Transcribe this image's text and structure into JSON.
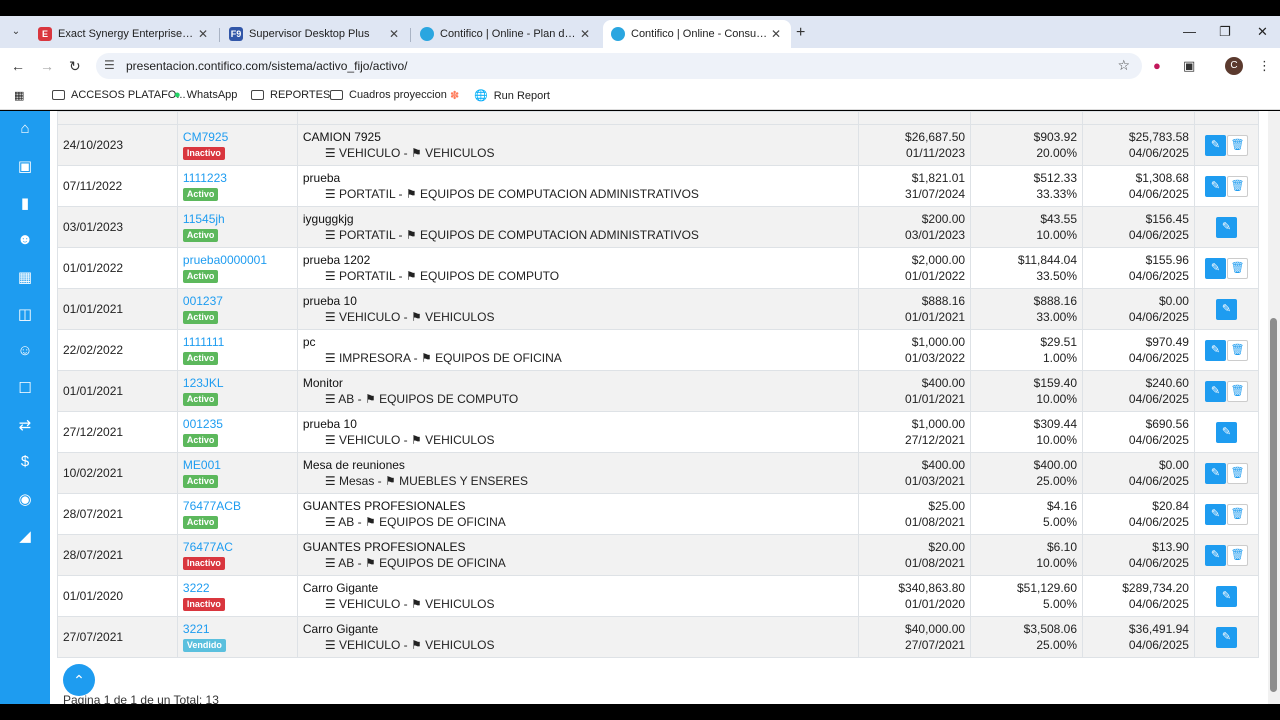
{
  "browser": {
    "tabs": [
      {
        "title": "Exact Synergy Enterprise - Caro",
        "favicon": "E",
        "color": "#d9363e"
      },
      {
        "title": "Supervisor Desktop Plus",
        "favicon": "F9",
        "color": "#3156a8"
      },
      {
        "title": "Contifico | Online - Plan de Cue",
        "favicon": "C",
        "color": "#2aa6e0"
      },
      {
        "title": "Contifico | Online - Consultar A",
        "favicon": "C",
        "color": "#2aa6e0"
      }
    ],
    "url": "presentacion.contifico.com/sistema/activo_fijo/activo/",
    "profile_initial": "C",
    "bookmarks": [
      {
        "label": "ACCESOS PLATAFO...",
        "icon": "folder-icon"
      },
      {
        "label": "WhatsApp",
        "icon": "whatsapp-icon"
      },
      {
        "label": "REPORTES",
        "icon": "folder-icon"
      },
      {
        "label": "Cuadros proyeccion",
        "icon": "folder-icon"
      },
      {
        "label": "",
        "icon": "hubspot-icon"
      },
      {
        "label": "Run Report",
        "icon": "globe-icon"
      }
    ]
  },
  "colors": {
    "accent": "#1e9cf0",
    "activo": "#5cb85c",
    "inactivo": "#d9363e",
    "vendido": "#5bc0de"
  },
  "rows": [
    {
      "date": "24/10/2023",
      "code": "CM7925",
      "status": "Inactivo",
      "name": "CAMION 7925",
      "cat": "VEHICULO - ",
      "group": "VEHICULOS",
      "cost": "$26,687.50",
      "cost_date": "01/11/2023",
      "dep": "$903.92",
      "rate": "20.00%",
      "book": "$25,783.58",
      "book_date": "04/06/2025",
      "deletable": true
    },
    {
      "date": "07/11/2022",
      "code": "1111223",
      "status": "Activo",
      "name": "prueba",
      "cat": "PORTATIL - ",
      "group": "EQUIPOS DE COMPUTACION ADMINISTRATIVOS",
      "cost": "$1,821.01",
      "cost_date": "31/07/2024",
      "dep": "$512.33",
      "rate": "33.33%",
      "book": "$1,308.68",
      "book_date": "04/06/2025",
      "deletable": true
    },
    {
      "date": "03/01/2023",
      "code": "11545jh",
      "status": "Activo",
      "name": "iyguggkjg",
      "cat": "PORTATIL - ",
      "group": "EQUIPOS DE COMPUTACION ADMINISTRATIVOS",
      "cost": "$200.00",
      "cost_date": "03/01/2023",
      "dep": "$43.55",
      "rate": "10.00%",
      "book": "$156.45",
      "book_date": "04/06/2025",
      "deletable": false
    },
    {
      "date": "01/01/2022",
      "code": "prueba0000001",
      "status": "Activo",
      "name": "prueba 1202",
      "cat": "PORTATIL - ",
      "group": "EQUIPOS DE COMPUTO",
      "cost": "$2,000.00",
      "cost_date": "01/01/2022",
      "dep": "$11,844.04",
      "rate": "33.50%",
      "book": "$155.96",
      "book_date": "04/06/2025",
      "deletable": true
    },
    {
      "date": "01/01/2021",
      "code": "001237",
      "status": "Activo",
      "name": "prueba 10",
      "cat": "VEHICULO - ",
      "group": "VEHICULOS",
      "cost": "$888.16",
      "cost_date": "01/01/2021",
      "dep": "$888.16",
      "rate": "33.00%",
      "book": "$0.00",
      "book_date": "04/06/2025",
      "deletable": false
    },
    {
      "date": "22/02/2022",
      "code": "1111111",
      "status": "Activo",
      "name": "pc",
      "cat": "IMPRESORA - ",
      "group": "EQUIPOS DE OFICINA",
      "cost": "$1,000.00",
      "cost_date": "01/03/2022",
      "dep": "$29.51",
      "rate": "1.00%",
      "book": "$970.49",
      "book_date": "04/06/2025",
      "deletable": true
    },
    {
      "date": "01/01/2021",
      "code": "123JKL",
      "status": "Activo",
      "name": "Monitor",
      "cat": "AB - ",
      "group": "EQUIPOS DE COMPUTO",
      "cost": "$400.00",
      "cost_date": "01/01/2021",
      "dep": "$159.40",
      "rate": "10.00%",
      "book": "$240.60",
      "book_date": "04/06/2025",
      "deletable": true
    },
    {
      "date": "27/12/2021",
      "code": "001235",
      "status": "Activo",
      "name": "prueba 10",
      "cat": "VEHICULO - ",
      "group": "VEHICULOS",
      "cost": "$1,000.00",
      "cost_date": "27/12/2021",
      "dep": "$309.44",
      "rate": "10.00%",
      "book": "$690.56",
      "book_date": "04/06/2025",
      "deletable": false
    },
    {
      "date": "10/02/2021",
      "code": "ME001",
      "status": "Activo",
      "name": "Mesa de reuniones",
      "cat": "Mesas - ",
      "group": "MUEBLES Y ENSERES",
      "cost": "$400.00",
      "cost_date": "01/03/2021",
      "dep": "$400.00",
      "rate": "25.00%",
      "book": "$0.00",
      "book_date": "04/06/2025",
      "deletable": true
    },
    {
      "date": "28/07/2021",
      "code": "76477ACB",
      "status": "Activo",
      "name": "GUANTES PROFESIONALES",
      "cat": "AB - ",
      "group": "EQUIPOS DE OFICINA",
      "cost": "$25.00",
      "cost_date": "01/08/2021",
      "dep": "$4.16",
      "rate": "5.00%",
      "book": "$20.84",
      "book_date": "04/06/2025",
      "deletable": true
    },
    {
      "date": "28/07/2021",
      "code": "76477AC",
      "status": "Inactivo",
      "name": "GUANTES PROFESIONALES",
      "cat": "AB - ",
      "group": "EQUIPOS DE OFICINA",
      "cost": "$20.00",
      "cost_date": "01/08/2021",
      "dep": "$6.10",
      "rate": "10.00%",
      "book": "$13.90",
      "book_date": "04/06/2025",
      "deletable": true
    },
    {
      "date": "01/01/2020",
      "code": "3222",
      "status": "Inactivo",
      "name": "Carro Gigante",
      "cat": "VEHICULO - ",
      "group": "VEHICULOS",
      "cost": "$340,863.80",
      "cost_date": "01/01/2020",
      "dep": "$51,129.60",
      "rate": "5.00%",
      "book": "$289,734.20",
      "book_date": "04/06/2025",
      "deletable": false
    },
    {
      "date": "27/07/2021",
      "code": "3221",
      "status": "Vendido",
      "name": "Carro Gigante",
      "cat": "VEHICULO - ",
      "group": "VEHICULOS",
      "cost": "$40,000.00",
      "cost_date": "27/07/2021",
      "dep": "$3,508.06",
      "rate": "25.00%",
      "book": "$36,491.94",
      "book_date": "04/06/2025",
      "deletable": false
    }
  ],
  "pager": "Pagina 1 de 1 de un Total: 13"
}
